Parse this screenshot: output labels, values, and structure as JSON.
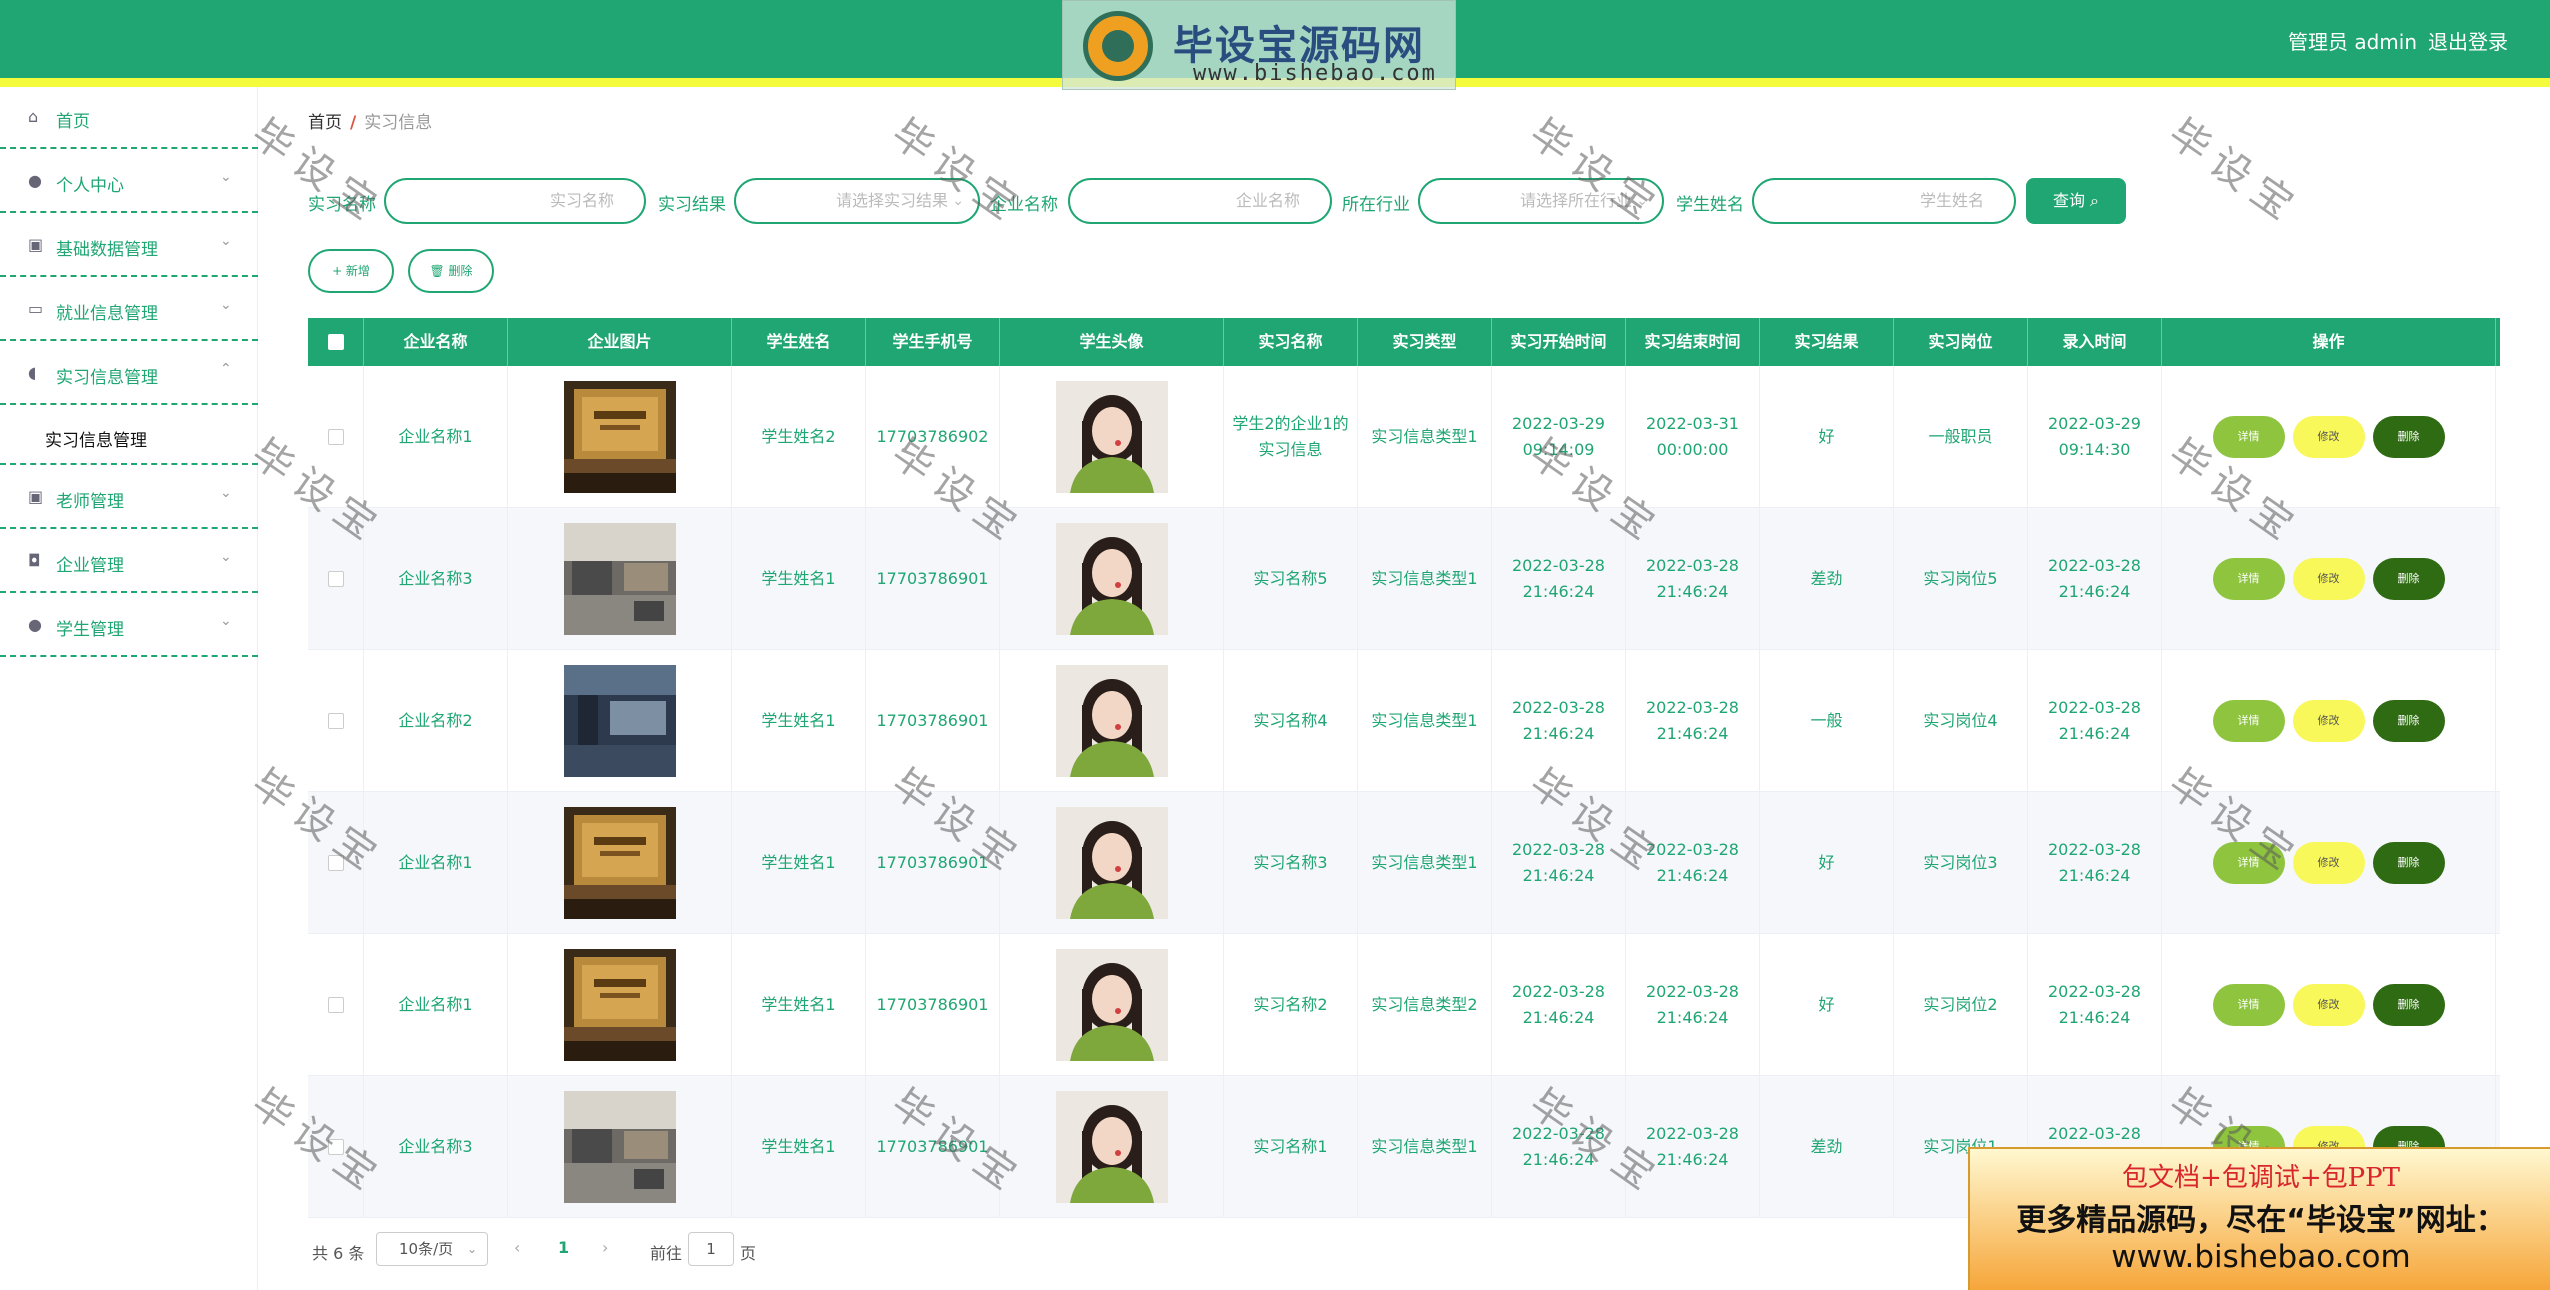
{
  "colors": {
    "primary": "#1fa673",
    "stripe": "#f4fb3c",
    "detail_btn": "#8fc43f",
    "edit_btn": "#f8f85a",
    "delete_btn": "#2f6b13"
  },
  "logo": {
    "title": "毕设宝源码网",
    "url": "www.bishebao.com"
  },
  "header": {
    "user": "管理员 admin",
    "logout": "退出登录"
  },
  "sidebar": {
    "items": [
      {
        "label": "首页",
        "icon": "home-icon"
      },
      {
        "label": "个人中心",
        "icon": "user-icon"
      },
      {
        "label": "基础数据管理",
        "icon": "clipboard-icon"
      },
      {
        "label": "就业信息管理",
        "icon": "monitor-icon"
      },
      {
        "label": "实习信息管理",
        "icon": "microphone-icon"
      },
      {
        "label": "老师管理",
        "icon": "clipboard-check-icon"
      },
      {
        "label": "企业管理",
        "icon": "bulb-icon"
      },
      {
        "label": "学生管理",
        "icon": "user-icon"
      }
    ],
    "sub_item": "实习信息管理"
  },
  "breadcrumb": {
    "home": "首页",
    "sep": "/",
    "current": "实习信息"
  },
  "filters": {
    "labels": [
      "实习名称",
      "实习结果",
      "企业名称",
      "所在行业",
      "学生姓名"
    ],
    "placeholders": [
      "实习名称",
      "请选择实习结果",
      "企业名称",
      "请选择所在行业",
      "学生姓名"
    ],
    "query_btn": "查询 ⌕"
  },
  "actions": {
    "add": "+ 新增",
    "delete": "🗑 删除"
  },
  "table": {
    "headers": [
      "企业名称",
      "企业图片",
      "学生姓名",
      "学生手机号",
      "学生头像",
      "实习名称",
      "实习类型",
      "实习开始时间",
      "实习结束时间",
      "实习结果",
      "实习岗位",
      "录入时间",
      "操作"
    ],
    "row_buttons": {
      "detail": "详情",
      "edit": "修改",
      "delete": "删除"
    },
    "rows": [
      {
        "company": "企业名称1",
        "student": "学生姓名2",
        "phone": "17703786902",
        "name": "学生2的企业1的实习信息",
        "type": "实习信息类型1",
        "start": "2022-03-29 09:14:09",
        "end": "2022-03-31 00:00:00",
        "result": "好",
        "post": "一般职员",
        "created": "2022-03-29 09:14:30",
        "img": "wall"
      },
      {
        "company": "企业名称3",
        "student": "学生姓名1",
        "phone": "17703786901",
        "name": "实习名称5",
        "type": "实习信息类型1",
        "start": "2022-03-28 21:46:24",
        "end": "2022-03-28 21:46:24",
        "result": "差劲",
        "post": "实习岗位5",
        "created": "2022-03-28 21:46:24",
        "img": "office"
      },
      {
        "company": "企业名称2",
        "student": "学生姓名1",
        "phone": "17703786901",
        "name": "实习名称4",
        "type": "实习信息类型1",
        "start": "2022-03-28 21:46:24",
        "end": "2022-03-28 21:46:24",
        "result": "一般",
        "post": "实习岗位4",
        "created": "2022-03-28 21:46:24",
        "img": "hall"
      },
      {
        "company": "企业名称1",
        "student": "学生姓名1",
        "phone": "17703786901",
        "name": "实习名称3",
        "type": "实习信息类型1",
        "start": "2022-03-28 21:46:24",
        "end": "2022-03-28 21:46:24",
        "result": "好",
        "post": "实习岗位3",
        "created": "2022-03-28 21:46:24",
        "img": "wall"
      },
      {
        "company": "企业名称1",
        "student": "学生姓名1",
        "phone": "17703786901",
        "name": "实习名称2",
        "type": "实习信息类型2",
        "start": "2022-03-28 21:46:24",
        "end": "2022-03-28 21:46:24",
        "result": "好",
        "post": "实习岗位2",
        "created": "2022-03-28 21:46:24",
        "img": "wall"
      },
      {
        "company": "企业名称3",
        "student": "学生姓名1",
        "phone": "17703786901",
        "name": "实习名称1",
        "type": "实习信息类型1",
        "start": "2022-03-28 21:46:24",
        "end": "2022-03-28 21:46:24",
        "result": "差劲",
        "post": "实习岗位1",
        "created": "2022-03-28 21:46:24",
        "img": "office"
      }
    ]
  },
  "pagination": {
    "total": "共 6 条",
    "page_size": "10条/页",
    "page": "1",
    "goto": "前往",
    "goto_value": "1",
    "unit": "页"
  },
  "watermark": "毕设宝",
  "ad": {
    "line1": "包文档+包调试+包PPT",
    "line2": "更多精品源码，尽在“毕设宝”网址：",
    "line3": "www.bishebao.com"
  }
}
